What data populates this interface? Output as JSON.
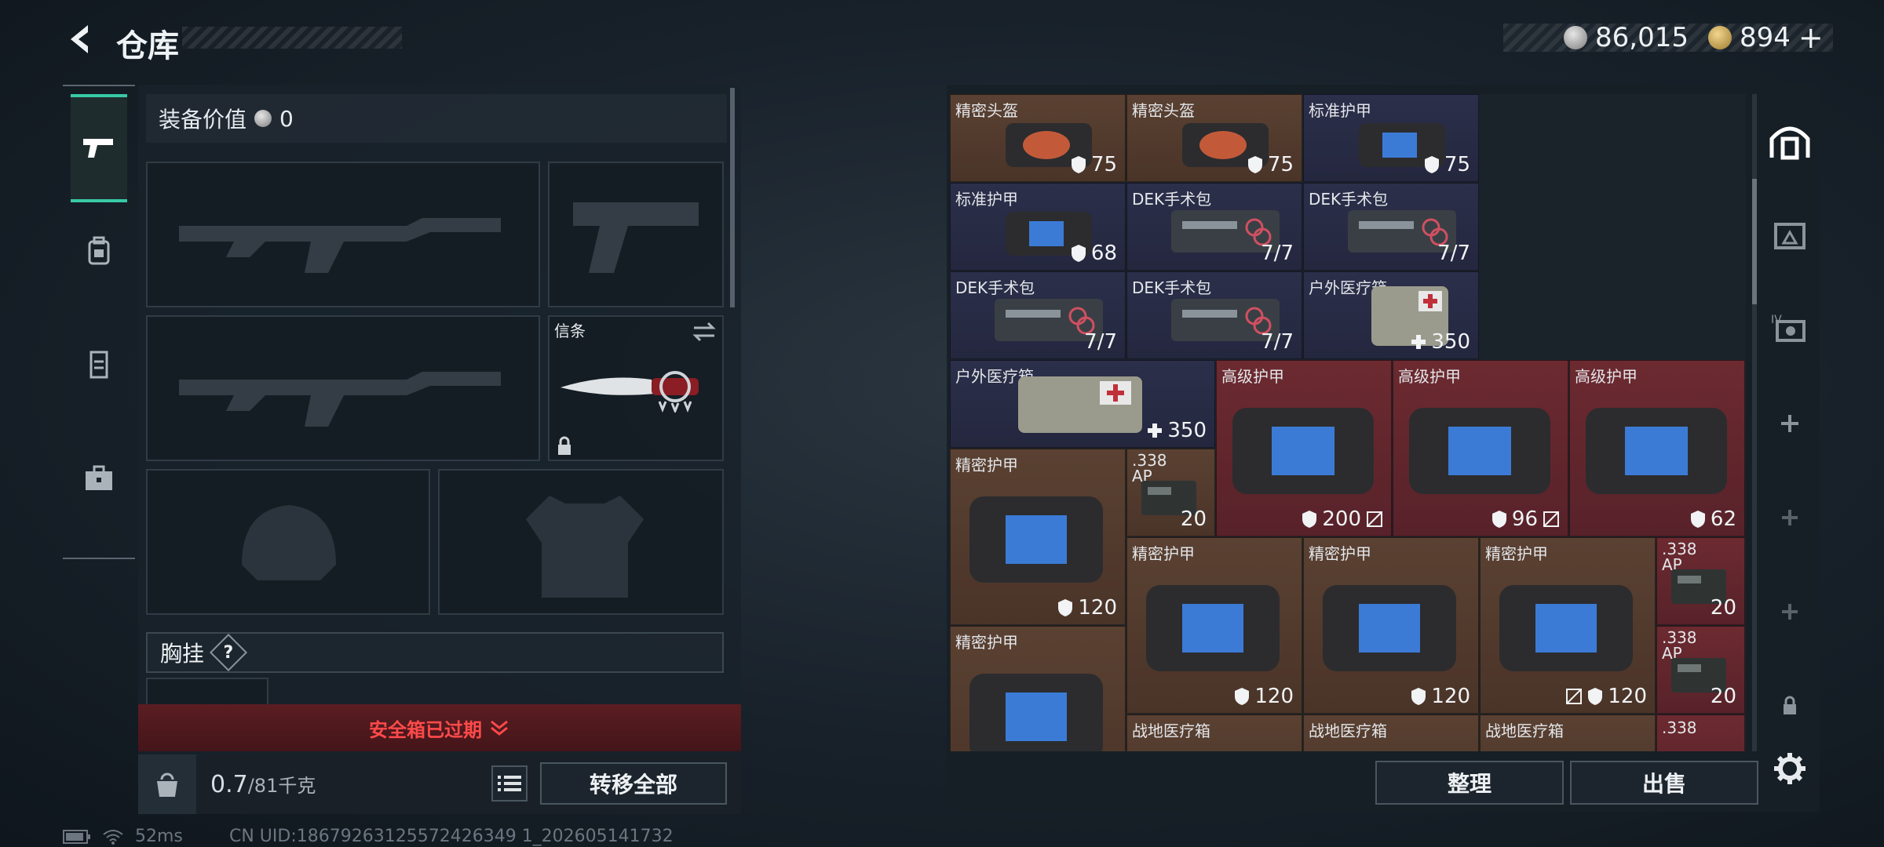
{
  "header": {
    "title": "仓库",
    "currency": {
      "silver": "86,015",
      "gold": "894"
    },
    "add_symbol": "+"
  },
  "equipment": {
    "value_label": "装备价值",
    "value": "0",
    "melee_label": "信条",
    "chest_label": "胸挂",
    "chest_help": "?",
    "safe_box_status": "安全箱已过期",
    "weight_current": "0.7",
    "weight_max": "/81千克",
    "transfer_all": "转移全部"
  },
  "stash": {
    "items": [
      {
        "name": "精密头盔",
        "value": "75",
        "icon": "shield-icon"
      },
      {
        "name": "精密头盔",
        "value": "75",
        "icon": "shield-icon"
      },
      {
        "name": "标准护甲",
        "value": "75",
        "icon": "shield-icon"
      },
      {
        "name": "标准护甲",
        "value": "68",
        "icon": "shield-icon"
      },
      {
        "name": "DEK手术包",
        "value": "7/7",
        "icon": ""
      },
      {
        "name": "DEK手术包",
        "value": "7/7",
        "icon": ""
      },
      {
        "name": "DEK手术包",
        "value": "7/7",
        "icon": ""
      },
      {
        "name": "DEK手术包",
        "value": "7/7",
        "icon": ""
      },
      {
        "name": "户外医疗箱",
        "value": "350",
        "icon": "plus-icon"
      },
      {
        "name": "户外医疗箱",
        "value": "350",
        "icon": "plus-icon"
      },
      {
        "name": "高级护甲",
        "value": "200",
        "icon": "shield-icon"
      },
      {
        "name": "高级护甲",
        "value": "96",
        "icon": "shield-icon"
      },
      {
        "name": "高级护甲",
        "value": "62",
        "icon": "shield-icon"
      },
      {
        "name": "精密护甲",
        "value": "120",
        "icon": "shield-icon"
      },
      {
        "name": ".338 AP",
        "value": "20",
        "icon": ""
      },
      {
        "name": "精密护甲",
        "value": "120",
        "icon": "shield-icon"
      },
      {
        "name": "精密护甲",
        "value": "120",
        "icon": "shield-icon"
      },
      {
        "name": "精密护甲",
        "value": "120",
        "icon": "shield-icon"
      },
      {
        "name": ".338 AP",
        "value": "20",
        "icon": ""
      },
      {
        "name": "精密护甲",
        "value": "",
        "icon": ""
      },
      {
        "name": ".338 AP",
        "value": "20",
        "icon": ""
      },
      {
        "name": "战地医疗箱",
        "value": "",
        "icon": ""
      },
      {
        "name": "战地医疗箱",
        "value": "",
        "icon": ""
      },
      {
        "name": "战地医疗箱",
        "value": "",
        "icon": ""
      },
      {
        "name": ".338",
        "value": "",
        "icon": ""
      }
    ],
    "sort_label": "整理",
    "sell_label": "出售"
  },
  "status": {
    "ping": "52ms",
    "uid": "CN UID:18679263125572426349 1_202605141732"
  },
  "colors": {
    "accent": "#38c9a6",
    "warning": "#ff4a4a",
    "brown_item": "#5a4132",
    "navy_item": "#2b2f4a",
    "red_item": "#6c2a30"
  }
}
